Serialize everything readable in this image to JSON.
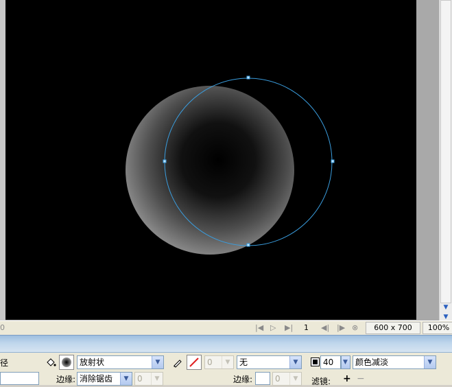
{
  "statusbar": {
    "first_frame_icon": "first-frame-icon",
    "play_icon": "play-icon",
    "last_frame_icon": "last-frame-icon",
    "frame_number": "1",
    "prev_frame_icon": "previous-frame-icon",
    "next_frame_icon": "next-frame-icon",
    "loop_icon": "loop-icon",
    "document_size": "600 x 700",
    "zoom": "100%"
  },
  "properties": {
    "left_label_fragment": "径",
    "fill_type": "放射状",
    "edge_label": "边缘:",
    "edge_value": "消除锯齿",
    "edge_amount": "0",
    "stroke_size": "0",
    "stroke_category": "无",
    "stroke_edge_label": "边缘:",
    "stroke_edge_value": "0",
    "opacity": "40",
    "blend_mode": "颜色减淡",
    "filters_label": "滤镜:",
    "add_filter": "+",
    "remove_filter": "−"
  },
  "colors": {
    "canvas": "#000000",
    "selection": "#3a9dde",
    "panel_gradient_top": "#9fbfdf"
  }
}
